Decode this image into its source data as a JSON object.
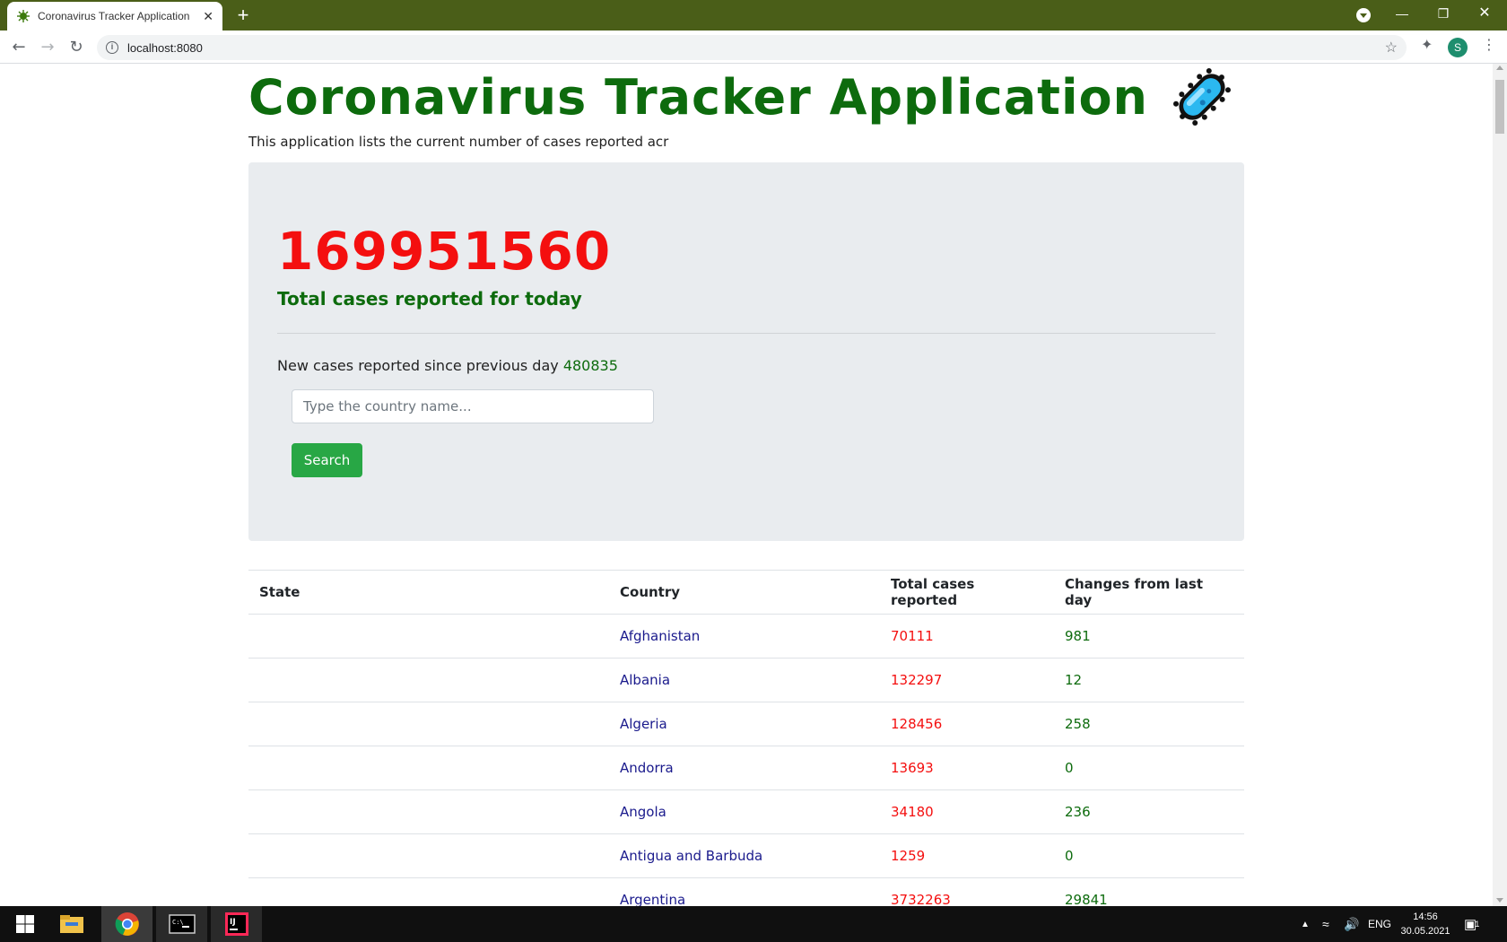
{
  "browser": {
    "tab_title": "Coronavirus Tracker Application",
    "tab_close": "✕",
    "new_tab": "+",
    "url": "localhost:8080",
    "profile_initial": "S"
  },
  "page": {
    "title": "Coronavirus Tracker Application",
    "subtitle": "This application lists the current number of cases reported acr",
    "total_cases": "169951560",
    "total_label": "Total cases reported for today",
    "new_cases_label": "New cases reported since previous day",
    "new_cases_value": "480835",
    "search_placeholder": "Type the country name...",
    "search_button": "Search"
  },
  "table": {
    "headers": [
      "State",
      "Country",
      "Total cases reported",
      "Changes from last day"
    ],
    "rows": [
      {
        "state": "",
        "country": "Afghanistan",
        "total": "70111",
        "change": "981"
      },
      {
        "state": "",
        "country": "Albania",
        "total": "132297",
        "change": "12"
      },
      {
        "state": "",
        "country": "Algeria",
        "total": "128456",
        "change": "258"
      },
      {
        "state": "",
        "country": "Andorra",
        "total": "13693",
        "change": "0"
      },
      {
        "state": "",
        "country": "Angola",
        "total": "34180",
        "change": "236"
      },
      {
        "state": "",
        "country": "Antigua and Barbuda",
        "total": "1259",
        "change": "0"
      },
      {
        "state": "",
        "country": "Argentina",
        "total": "3732263",
        "change": "29841"
      }
    ]
  },
  "taskbar": {
    "language": "ENG",
    "time": "14:56",
    "date": "30.05.2021",
    "notification_count": "1"
  },
  "colors": {
    "tabbar": "#4a5e18",
    "title_green": "#0d6b0d",
    "number_red": "#f40f0f",
    "country_blue": "#1a1a8c",
    "button_green": "#28a745"
  }
}
